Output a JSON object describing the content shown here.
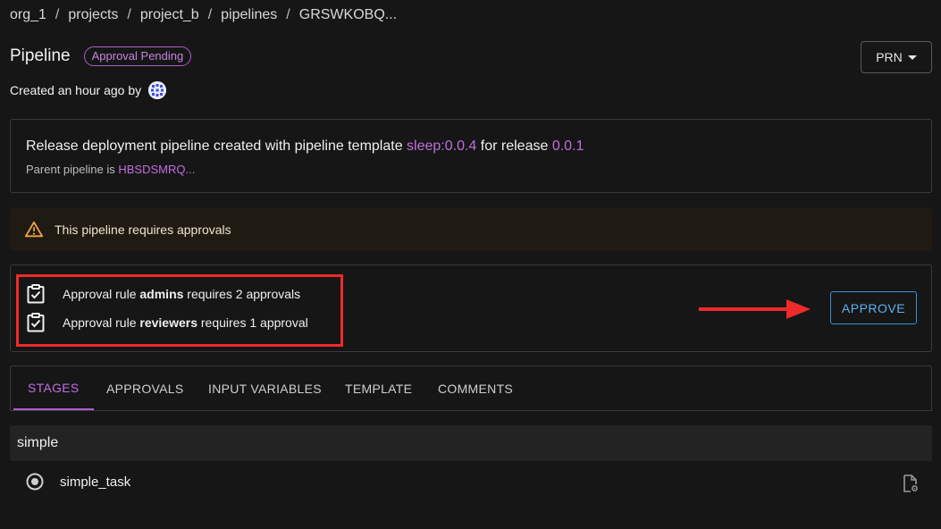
{
  "breadcrumb": [
    "org_1",
    "projects",
    "project_b",
    "pipelines",
    "GRSWKOBQ..."
  ],
  "breadcrumb_separator": "/",
  "header": {
    "title": "Pipeline",
    "status_badge": "Approval Pending",
    "prn_button_label": "PRN",
    "created_text": "Created an hour ago by"
  },
  "description": {
    "prefix": "Release deployment pipeline created with pipeline template",
    "template_link": "sleep:0.0.4",
    "middle": "for release",
    "release_link": "0.0.1",
    "parent_prefix": "Parent pipeline is",
    "parent_link": "HBSDSMRQ..."
  },
  "warning": {
    "text": "This pipeline requires approvals",
    "color": "#f0a43a"
  },
  "approval_rules": [
    {
      "prefix": "Approval rule",
      "rule": "admins",
      "suffix": "requires 2 approvals"
    },
    {
      "prefix": "Approval rule",
      "rule": "reviewers",
      "suffix": "requires 1 approval"
    }
  ],
  "approve_button_label": "APPROVE",
  "tabs": [
    {
      "label": "STAGES",
      "active": true
    },
    {
      "label": "APPROVALS",
      "active": false
    },
    {
      "label": "INPUT VARIABLES",
      "active": false
    },
    {
      "label": "TEMPLATE",
      "active": false
    },
    {
      "label": "COMMENTS",
      "active": false
    }
  ],
  "stage": {
    "name": "simple",
    "tasks": [
      {
        "name": "simple_task",
        "icon": "radio-status-icon"
      }
    ]
  },
  "colors": {
    "accent": "#b15ccf",
    "approve": "#3d8fcf",
    "annotation": "#ef2a2a"
  }
}
